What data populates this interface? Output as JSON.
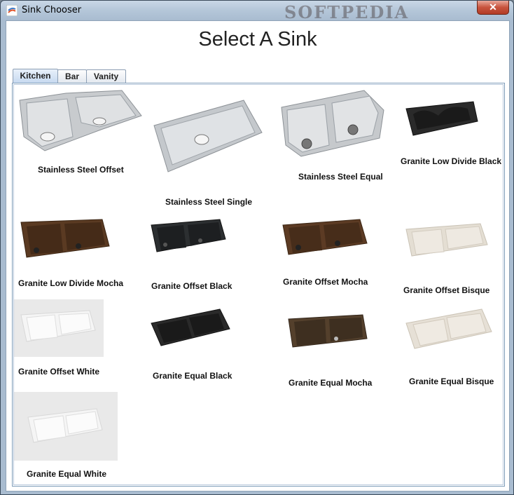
{
  "window": {
    "title": "Sink Chooser",
    "close_glyph": "✕",
    "watermark": "SOFTPEDIA"
  },
  "heading": "Select A Sink",
  "tabs": [
    {
      "label": "Kitchen",
      "active": true
    },
    {
      "label": "Bar",
      "active": false
    },
    {
      "label": "Vanity",
      "active": false
    }
  ],
  "sinks": [
    {
      "name": "Stainless Steel Offset",
      "style": "stainless-double-offset"
    },
    {
      "name": "Stainless Steel Single",
      "style": "stainless-single"
    },
    {
      "name": "Stainless Steel Equal",
      "style": "stainless-double-equal"
    },
    {
      "name": "Granite Low Divide Black",
      "style": "granite-low-divide",
      "color": "#2a2a2a"
    },
    {
      "name": "Granite Low Divide Mocha",
      "style": "granite-double-offset",
      "color": "#5a3a22"
    },
    {
      "name": "Granite Offset Black",
      "style": "granite-double-offset",
      "color": "#2c2f31"
    },
    {
      "name": "Granite Offset Mocha",
      "style": "granite-double-offset",
      "color": "#5c3b24"
    },
    {
      "name": "Granite Offset Bisque",
      "style": "granite-double-offset",
      "color": "#e4ded3"
    },
    {
      "name": "Granite Offset White",
      "style": "granite-double-offset",
      "color": "#f4f4f4"
    },
    {
      "name": "Granite Equal Black",
      "style": "granite-double-equal",
      "color": "#2a2a2a"
    },
    {
      "name": "Granite Equal Mocha",
      "style": "granite-double-equal",
      "color": "#54402c"
    },
    {
      "name": "Granite Equal Bisque",
      "style": "granite-double-equal",
      "color": "#e6e0d6"
    },
    {
      "name": "Granite Equal White",
      "style": "granite-double-equal",
      "color": "#f4f4f4"
    }
  ]
}
